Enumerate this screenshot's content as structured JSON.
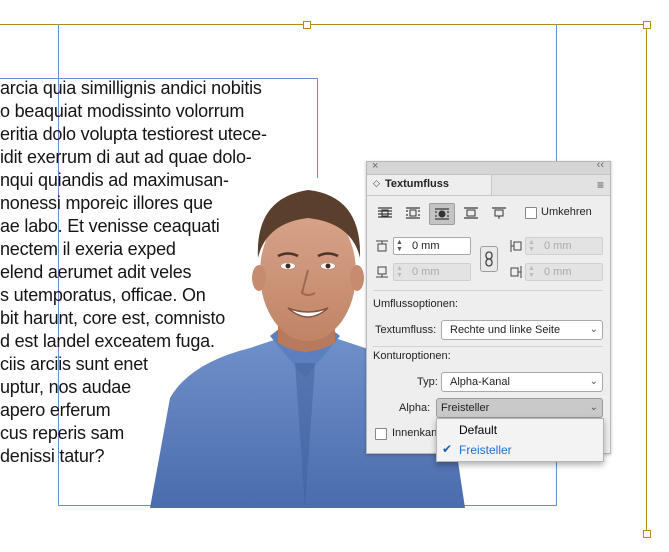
{
  "body_text": {
    "lines": [
      "arcia quia simillignis andici nobitis",
      "o beaquiat modissinto volorrum",
      "eritia dolo volupta testiorest utece-",
      "idit exerrum di aut ad quae dolo-",
      "nqui quiandis ad maximusan-",
      "nonessi mporeic illores que",
      "ae labo. Et venisse ceaquati",
      "nectem il exeria exped",
      "elend aerumet adit veles",
      "s utemporatus, officae. On",
      "bit harunt, core est, comnisto",
      "d est landel exceatem fuga.",
      "ciis arciis sunt enet",
      "uptur, nos audae",
      "apero erferum",
      "cus reperis sam",
      "denissi tatur?"
    ]
  },
  "panel": {
    "title": "Textumfluss",
    "close_glyph": "×",
    "collapse_glyph": "‹‹",
    "menu_glyph": "≡",
    "wrap_buttons": [
      "no-wrap-icon",
      "wrap-bounding-box-icon",
      "wrap-object-shape-icon",
      "jump-object-icon",
      "jump-next-column-icon"
    ],
    "invert_label": "Umkehren",
    "offset_top": "0 mm",
    "offset_bottom": "0 mm",
    "offset_left": "0 mm",
    "offset_right": "0 mm",
    "wrap_options_label": "Umflussoptionen:",
    "wrap_to_label": "Textumfluss:",
    "wrap_to_value": "Rechte und linke Seite",
    "contour_options_label": "Konturoptionen:",
    "type_label": "Typ:",
    "type_value": "Alpha-Kanal",
    "alpha_label": "Alpha:",
    "alpha_value": "Freisteller",
    "inner_label": "Innenkan",
    "alpha_options": [
      "Default",
      "Freisteller"
    ],
    "alpha_selected_index": 1,
    "check_glyph": "✔"
  },
  "colors": {
    "frame": "#b58a1a",
    "guide": "#6d8fc9",
    "selected": "#1a6fd0"
  }
}
